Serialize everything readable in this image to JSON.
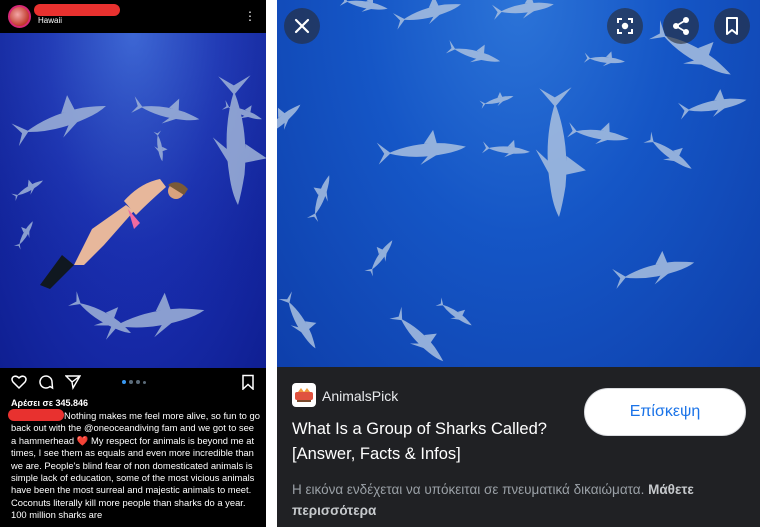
{
  "instagram": {
    "location": "Hawaii",
    "more_icon": "⋮",
    "likes": "Αρέσει σε 345.846",
    "caption_part1": "Nothing makes me feel more alive, so fun to go back out with the @oneoceandiving fam and we got to see a hammerhead ",
    "caption_heart": "❤️",
    "caption_part2": " My respect for animals is beyond me at times, I see them as equals and even more incredible than we are. People's blind fear of non domesticated animals is simple lack of education, some of the most vicious animals have been the most surreal and majestic animals to meet. Coconuts literally kill more people than sharks do a year. 100 million sharks are",
    "icons": [
      "heart-icon",
      "comment-icon",
      "share-icon",
      "bookmark-icon"
    ],
    "redaction_color": "#e8312f"
  },
  "viewer": {
    "source_name": "AnimalsPick",
    "title": "What Is a Group of Sharks Called? [Answer, Facts & Infos]",
    "visit_label": "Επίσκεψη",
    "copyright_text": "Η εικόνα ενδέχεται να υπόκειται σε πνευματικά δικαιώματα.",
    "learn_more": "Μάθετε περισσότερα",
    "top_icons": [
      "close-icon",
      "lens-icon",
      "share-icon",
      "bookmark-icon"
    ],
    "accent_color": "#1a73e8",
    "panel_bg": "#202124"
  }
}
